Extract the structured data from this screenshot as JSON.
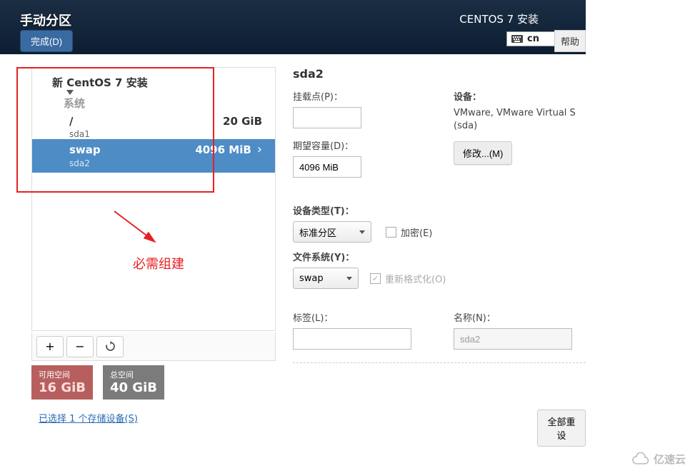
{
  "header": {
    "title": "手动分区",
    "done_label": "完成(D)",
    "installer_title": "CENTOS 7 安装",
    "lang_code": "cn",
    "help_label": "帮助"
  },
  "tree": {
    "root_label": "新 CentOS 7 安装",
    "system_label": "系统",
    "partitions": [
      {
        "mount": "/",
        "device": "sda1",
        "size": "20 GiB",
        "selected": false
      },
      {
        "mount": "swap",
        "device": "sda2",
        "size": "4096 MiB",
        "selected": true
      }
    ]
  },
  "annotation": {
    "required_text": "必需组建"
  },
  "toolbar": {
    "add": "+",
    "remove": "−",
    "reload_icon": "reload"
  },
  "space": {
    "available_label": "可用空间",
    "available_value": "16 GiB",
    "total_label": "总空间",
    "total_value": "40 GiB"
  },
  "storage_link": "已选择 1 个存储设备(S)",
  "details": {
    "title": "sda2",
    "mount_label": "挂载点(P)：",
    "mount_value": "",
    "desired_label": "期望容量(D)：",
    "desired_value": "4096 MiB",
    "device_label": "设备：",
    "device_text": "VMware, VMware Virtual S (sda)",
    "modify_label": "修改...(M)",
    "devtype_label": "设备类型(T)：",
    "devtype_value": "标准分区",
    "encrypt_label": "加密(E)",
    "fs_label": "文件系统(Y)：",
    "fs_value": "swap",
    "reformat_label": "重新格式化(O)",
    "label_label": "标签(L)：",
    "label_value": "",
    "name_label": "名称(N)：",
    "name_value": "sda2",
    "reset_label": "全部重设"
  },
  "watermark": "亿速云"
}
